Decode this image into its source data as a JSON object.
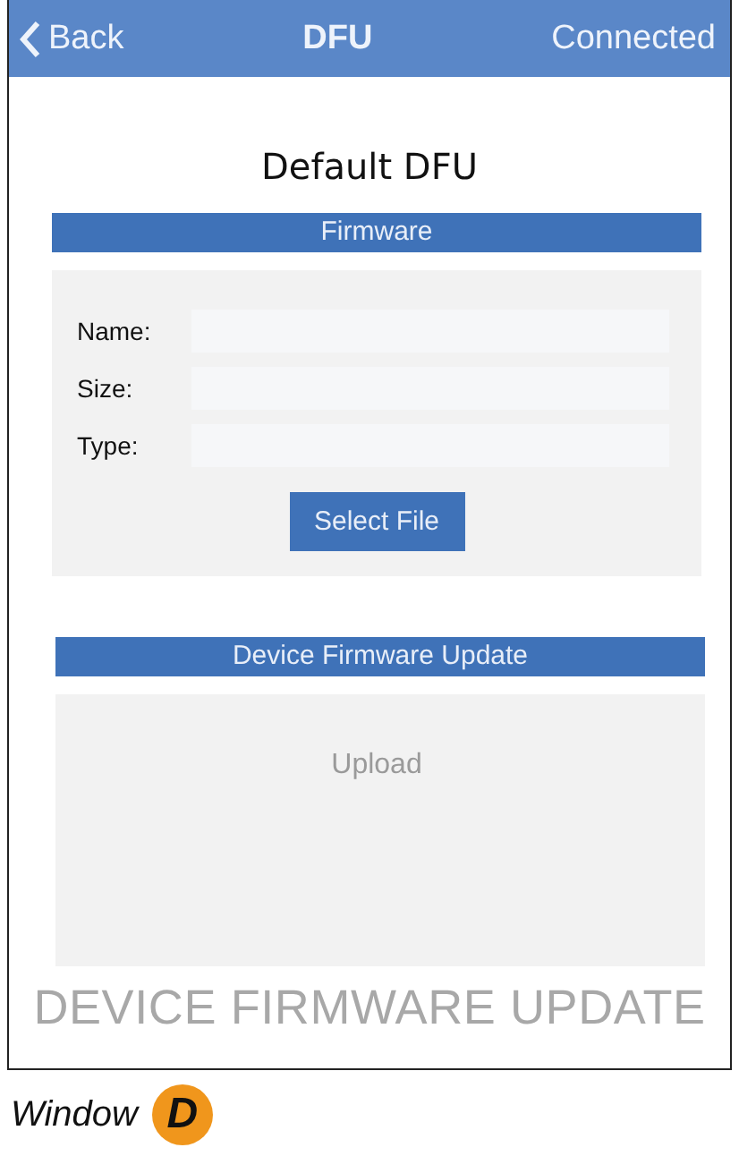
{
  "nav_bar": {
    "back": "Back",
    "title": "DFU",
    "status": "Connected"
  },
  "heading": "Default DFU",
  "firmware": {
    "title": "Firmware",
    "fields": [
      {
        "label": "Name:"
      },
      {
        "label": "Size:"
      },
      {
        "label": "Type:"
      }
    ],
    "button": "Select File"
  },
  "update": {
    "title": "Device Firmware Update",
    "upload": "Upload",
    "banner": "DEVICE FIRMWARE UPDATE"
  },
  "caption": {
    "text": "Window",
    "badge": "D"
  }
}
